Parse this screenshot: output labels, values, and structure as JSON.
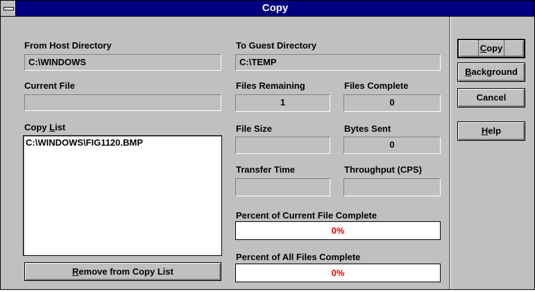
{
  "window": {
    "title": "Copy"
  },
  "labels": {
    "from_host": "From Host Directory",
    "to_guest": "To Guest Directory",
    "current_file": "Current File",
    "files_remaining": "Files Remaining",
    "files_complete": "Files Complete",
    "copy_list_prefix": "Copy ",
    "copy_list_mnemonic": "L",
    "copy_list_suffix": "ist",
    "file_size": "File Size",
    "bytes_sent": "Bytes Sent",
    "transfer_time": "Transfer Time",
    "throughput": "Throughput (CPS)",
    "pct_current": "Percent of Current File Complete",
    "pct_all": "Percent of All Files Complete"
  },
  "values": {
    "from_host": "C:\\WINDOWS",
    "to_guest": "C:\\TEMP",
    "current_file": "",
    "files_remaining": "1",
    "files_complete": "0",
    "file_size": "",
    "bytes_sent": "0",
    "transfer_time": "",
    "throughput": ""
  },
  "copy_list": {
    "items": [
      "C:\\WINDOWS\\FIG1120.BMP"
    ]
  },
  "progress": {
    "current_file": {
      "text": "0%",
      "fraction": 0
    },
    "all_files": {
      "text": "0%",
      "fraction": 0
    }
  },
  "buttons": {
    "copy": {
      "mnemonic": "C",
      "rest": "opy"
    },
    "background": {
      "mnemonic": "B",
      "rest": "ackground"
    },
    "cancel": {
      "label": "Cancel"
    },
    "help": {
      "mnemonic": "H",
      "rest": "elp"
    },
    "remove": {
      "mnemonic": "R",
      "rest": "emove from Copy List"
    }
  },
  "colors": {
    "title_bar": "#000080",
    "dialog_bg": "#c0c0c0",
    "progress_text": "#e00000"
  }
}
